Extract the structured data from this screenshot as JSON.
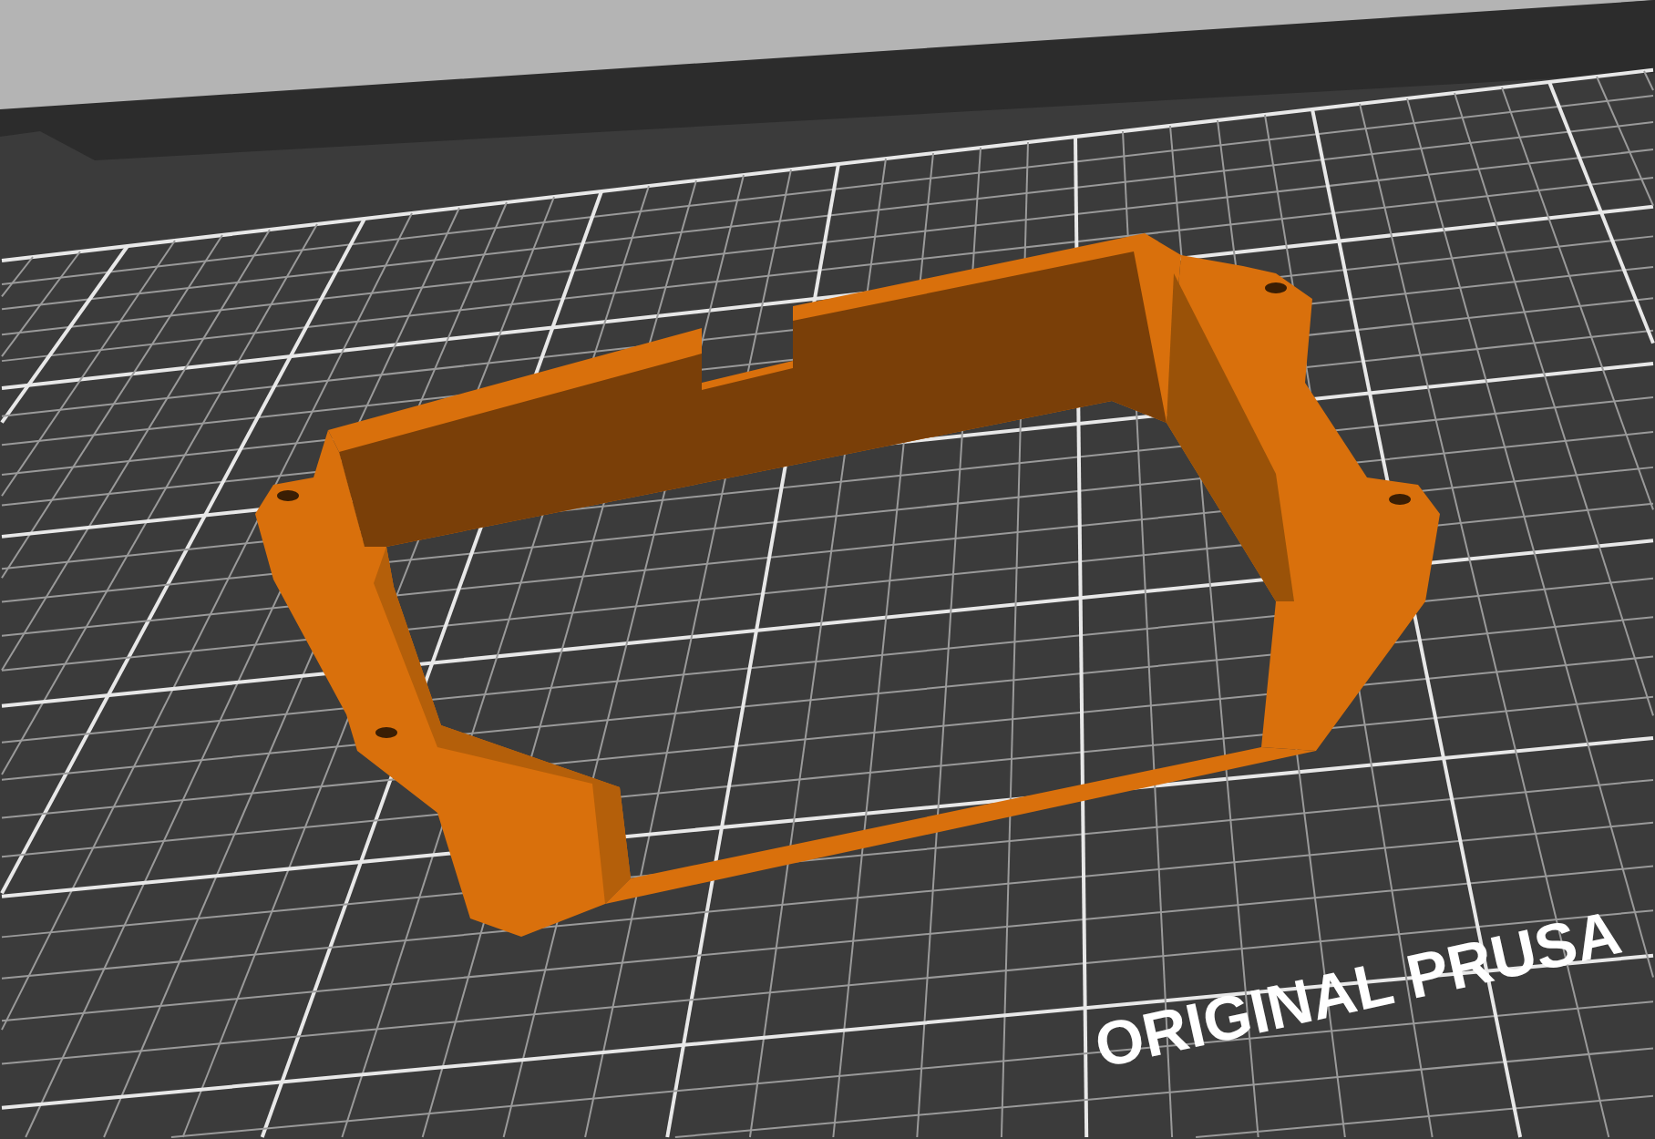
{
  "viewport": {
    "bed_label": "ORIGINAL PRUSA"
  }
}
